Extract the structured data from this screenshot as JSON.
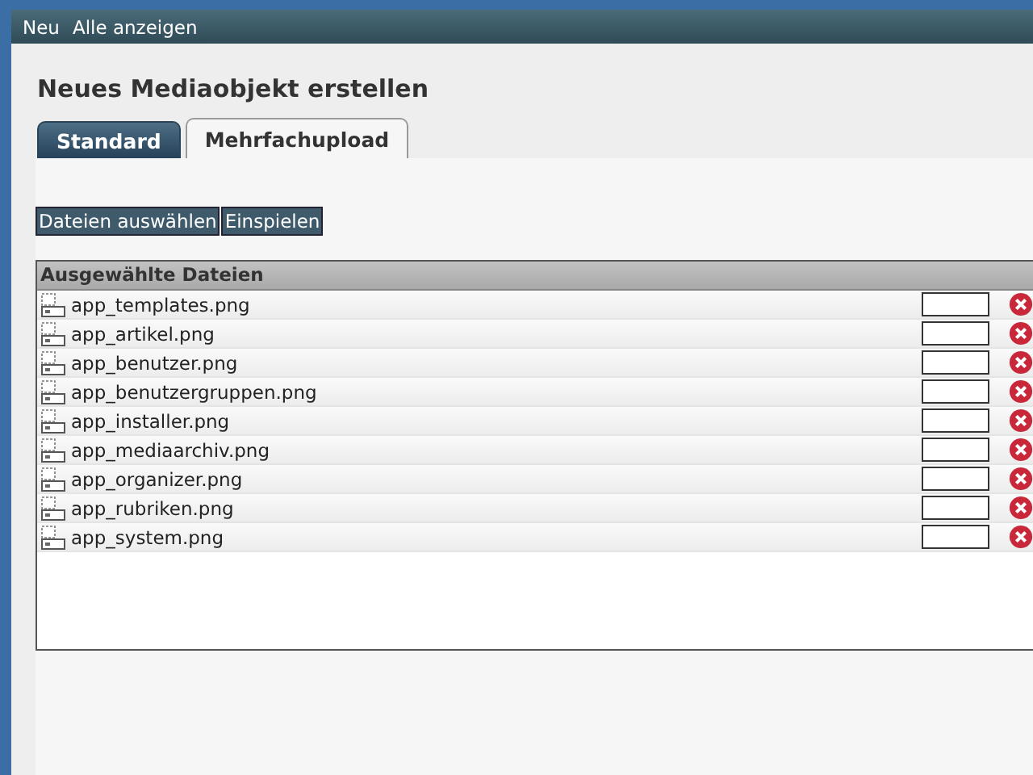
{
  "menu": [
    {
      "label": "Neu"
    },
    {
      "label": "Alle anzeigen"
    }
  ],
  "title": "Neues Mediaobjekt erstellen",
  "tabs": [
    {
      "label": "Standard",
      "selected": false
    },
    {
      "label": "Mehrfachupload",
      "selected": true
    }
  ],
  "buttons": [
    "Dateien auswählen",
    "Einspielen"
  ],
  "files": {
    "heading": "Ausgewählte Dateien",
    "rows": [
      {
        "name": "app_templates.png"
      },
      {
        "name": "app_artikel.png"
      },
      {
        "name": "app_benutzer.png"
      },
      {
        "name": "app_benutzergruppen.png"
      },
      {
        "name": "app_installer.png"
      },
      {
        "name": "app_mediaarchiv.png"
      },
      {
        "name": "app_organizer.png"
      },
      {
        "name": "app_rubriken.png"
      },
      {
        "name": "app_system.png"
      }
    ]
  }
}
